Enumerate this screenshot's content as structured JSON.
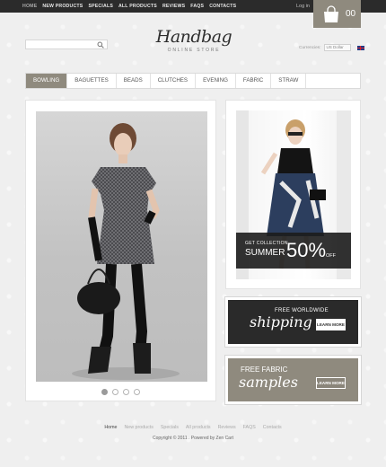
{
  "top_nav": {
    "items": [
      "HOME",
      "NEW PRODUCTS",
      "SPECIALS",
      "ALL PRODUCTS",
      "REVIEWS",
      "FAQS",
      "CONTACTS"
    ],
    "login": "Log in",
    "cart_count": "00"
  },
  "header": {
    "search_placeholder": "",
    "logo_script": "Handbag",
    "logo_sub": "ONLINE STORE",
    "currency_label": "Currencies:",
    "currency_value": "US Dollar"
  },
  "categories": {
    "items": [
      "BOWLING",
      "BAGUETTES",
      "BEADS",
      "CLUTCHES",
      "EVENING",
      "FABRIC",
      "STRAW"
    ],
    "active": "BOWLING"
  },
  "slideshow": {
    "dots": 4,
    "active_dot": 0
  },
  "promos": {
    "summer_get": "GET COLLECTION",
    "summer_word": "SUMMER",
    "summer_pct": "50%",
    "summer_off": "OFF",
    "shipping_line1": "FREE WORLDWIDE",
    "shipping_line2": "shipping",
    "shipping_btn": "LEARN MORE",
    "fabric_line1": "FREE FABRIC",
    "fabric_line2": "samples",
    "fabric_btn": "LEARN MORE"
  },
  "footer": {
    "links": [
      "Home",
      "New products",
      "Specials",
      "All products",
      "Reviews",
      "FAQS",
      "Contacts"
    ],
    "copyright": "Copyright © 2011 . Powered by Zen Cart"
  },
  "colors": {
    "accent": "#8f8a7e",
    "topbar": "#2b2b2b"
  }
}
